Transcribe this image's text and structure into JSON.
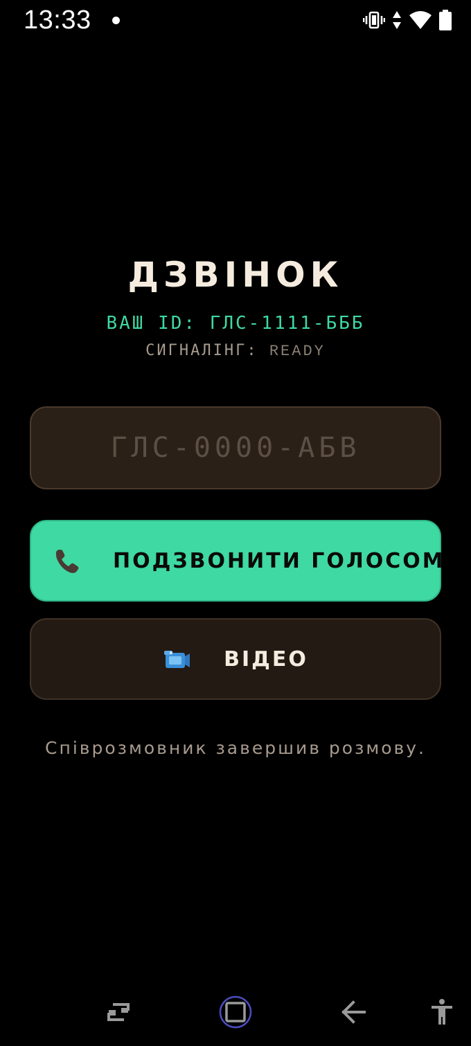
{
  "status_bar": {
    "time": "13:33"
  },
  "header": {
    "title": "ДЗВІНОК",
    "id_label": "ВАШ ID:",
    "id_value": "ГЛС-1111-БББ",
    "signaling_label": "СИГНАЛІНГ:",
    "signaling_value": "READY"
  },
  "peer_input": {
    "placeholder": "ГЛС-0000-АБВ",
    "value": ""
  },
  "buttons": {
    "voice_label": "ПОДЗВОНИТИ ГОЛОСОМ",
    "video_label": "ВІДЕО"
  },
  "call_status": "Співрозмовник завершив розмову.",
  "icons": {
    "voice": "phone-icon",
    "video": "video-camera-icon",
    "status": [
      "vibrate-icon",
      "data-arrows-icon",
      "wifi-icon",
      "battery-icon"
    ],
    "nav": [
      "rotate-icon",
      "home-icon",
      "back-icon",
      "accessibility-icon"
    ]
  },
  "colors": {
    "accent": "#3fd9a3",
    "background": "#000000",
    "surface": "#231a13",
    "title": "#f5ecdf",
    "muted_text": "#a89b8e"
  }
}
